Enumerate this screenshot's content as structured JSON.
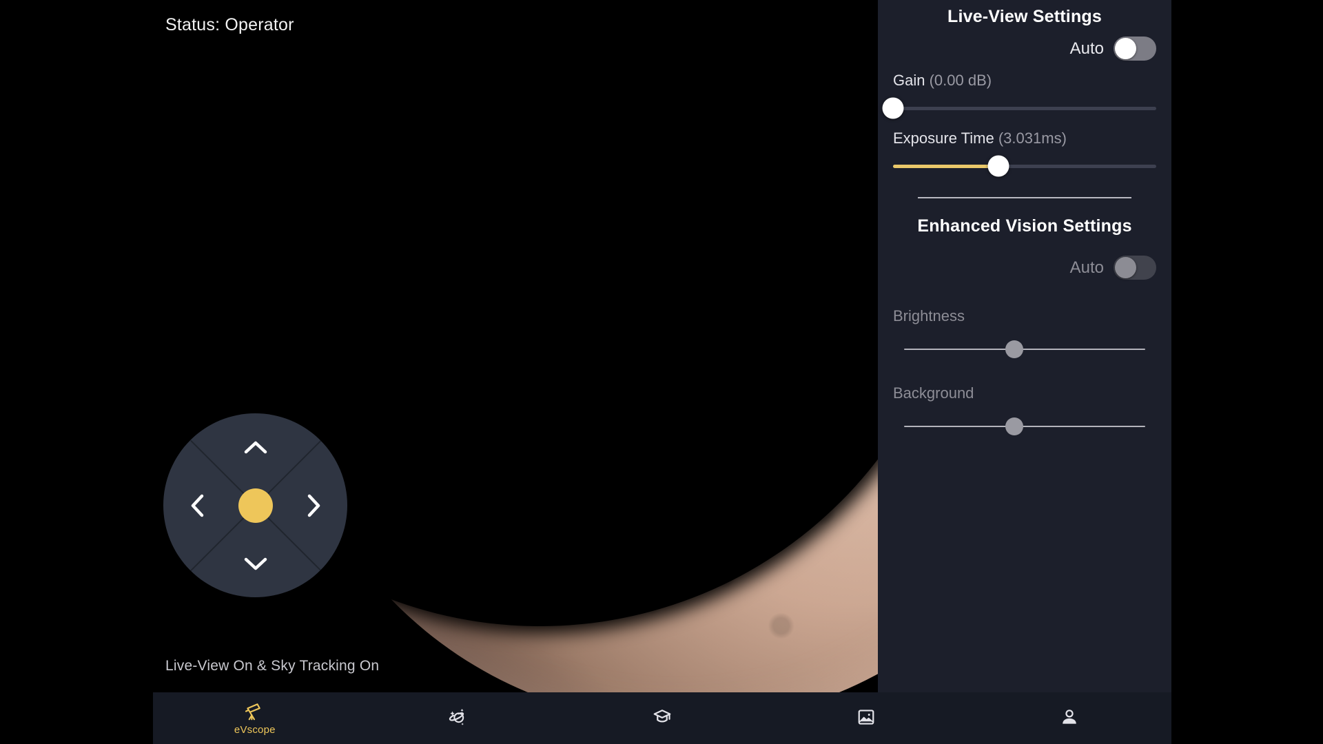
{
  "liveview": {
    "status_top": "Status: Operator",
    "status_bottom": "Live-View On & Sky Tracking On",
    "subject": "crescent-moon"
  },
  "dpad": {
    "up_icon": "chevron-up-icon",
    "down_icon": "chevron-down-icon",
    "left_icon": "chevron-left-icon",
    "right_icon": "chevron-right-icon",
    "center_label": "",
    "center_color": "#eec65a"
  },
  "settings": {
    "live_view": {
      "title": "Live-View Settings",
      "auto_label": "Auto",
      "auto_on": false,
      "gain": {
        "label": "Gain",
        "value_text": "(0.00 dB)",
        "percent": 0
      },
      "exposure": {
        "label": "Exposure Time",
        "value_text": "(3.031ms)",
        "percent": 40
      }
    },
    "enhanced_vision": {
      "title": "Enhanced Vision Settings",
      "auto_label": "Auto",
      "auto_on": false,
      "brightness": {
        "label": "Brightness",
        "percent": 46
      },
      "background": {
        "label": "Background",
        "percent": 46
      }
    }
  },
  "bottom_nav": {
    "items": [
      {
        "label": "eVscope",
        "icon": "telescope-icon",
        "active": true
      },
      {
        "label": "",
        "icon": "planet-sparkle-icon",
        "active": false
      },
      {
        "label": "",
        "icon": "graduation-cap-icon",
        "active": false
      },
      {
        "label": "",
        "icon": "gallery-image-icon",
        "active": false
      },
      {
        "label": "",
        "icon": "person-profile-icon",
        "active": false
      }
    ]
  },
  "colors": {
    "accent": "#eec65a",
    "panel_bg": "#1c1f2b",
    "nav_bg": "#161a24",
    "dpad_bg": "#2f3542"
  }
}
